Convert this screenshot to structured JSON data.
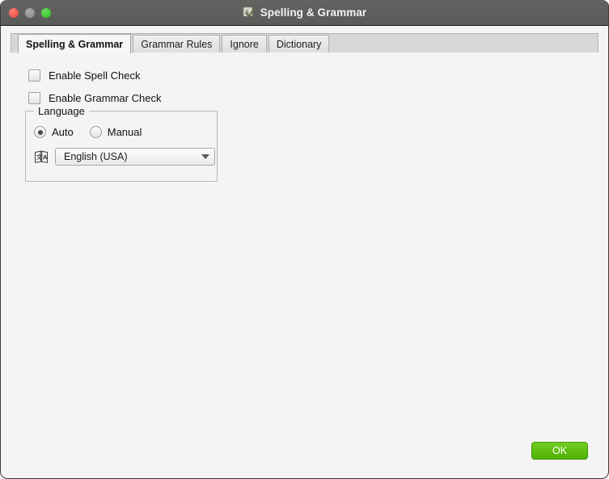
{
  "window": {
    "title": "Spelling & Grammar",
    "title_icon": "spellcheck-icon",
    "traffic_lights": {
      "close": "close-window-button",
      "minimize": "minimize-window-button",
      "maximize": "maximize-window-button"
    },
    "colors": {
      "titlebar": "#5c5e5c",
      "body": "#f4f4f4",
      "tabstrip": "#d7d7d7",
      "accent_ok": "#5cbf0d"
    }
  },
  "tabs": [
    {
      "label": "Spelling & Grammar",
      "active": true
    },
    {
      "label": "Grammar Rules",
      "active": false
    },
    {
      "label": "Ignore",
      "active": false
    },
    {
      "label": "Dictionary",
      "active": false
    }
  ],
  "options": [
    {
      "label": "Enable Spell Check",
      "checked": false
    },
    {
      "label": "Enable Grammar Check",
      "checked": false
    }
  ],
  "language_group": {
    "title": "Language",
    "radios": [
      {
        "label": "Auto",
        "selected": true
      },
      {
        "label": "Manual",
        "selected": false
      }
    ],
    "icon": "translate-book-icon",
    "combo": {
      "value": "English (USA)",
      "arrow": "chevron-down-icon"
    }
  },
  "footer": {
    "ok_label": "OK"
  }
}
